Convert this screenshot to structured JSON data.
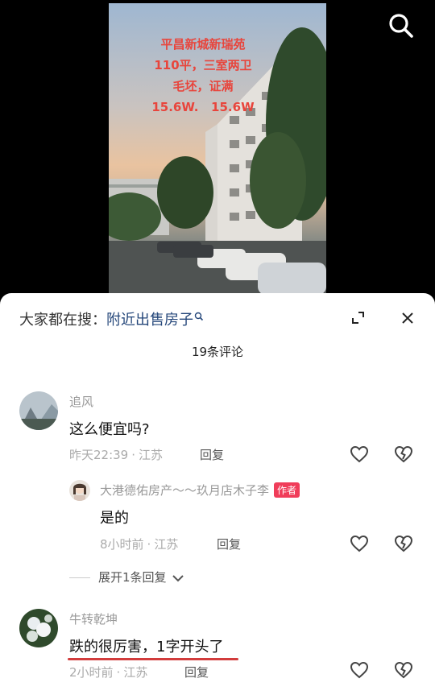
{
  "video": {
    "overlay_lines": [
      "平昌新城新瑞苑",
      "110平，三室两卫",
      "毛坯，证满",
      "15.6W.   15.6W"
    ]
  },
  "search_bar": {
    "prefix": "大家都在搜：",
    "query": "附近出售房子"
  },
  "comments_header": {
    "count_label": "19条评论"
  },
  "comments": [
    {
      "username": "追风",
      "text": "这么便宜吗?",
      "time": "昨天22:39",
      "location": "江苏",
      "reply_label": "回复"
    },
    {
      "username": "大港德佑房产～～玖月店木子李",
      "author_tag": "作者",
      "text": "是的",
      "time": "8小时前",
      "location": "江苏",
      "reply_label": "回复"
    },
    {
      "username": "牛转乾坤",
      "text": "跌的很厉害，1字开头了",
      "time": "2小时前",
      "location": "江苏",
      "reply_label": "回复"
    }
  ],
  "expand_replies": {
    "label": "展开1条回复"
  },
  "separator": "·",
  "colors": {
    "accent_red": "#d23c3c",
    "author_tag": "#f03d5a",
    "link_blue": "#25477a"
  }
}
